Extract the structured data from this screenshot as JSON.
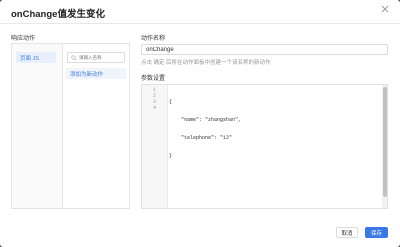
{
  "dialog": {
    "title": "onChange值发生变化",
    "close_icon": "close-icon"
  },
  "left": {
    "section_label": "响应动作",
    "page_js_label": "页面 JS",
    "search_placeholder": "请输入名称",
    "add_new_label": "添加为新动作"
  },
  "right": {
    "name_label": "动作名称",
    "name_value": "onChange",
    "hint": "点击 确定 后将在动作面板中创建一个该名称的新动作",
    "params_label": "参数设置",
    "code_lines": [
      "{",
      "    \"name\": \"zhangshan\",",
      "    \"telephone\": \"12\"",
      "}"
    ],
    "line_numbers": [
      "1",
      "2",
      "3",
      "4"
    ]
  },
  "footer": {
    "cancel_label": "取消",
    "save_label": "保存"
  },
  "colors": {
    "accent": "#3b78e7"
  }
}
